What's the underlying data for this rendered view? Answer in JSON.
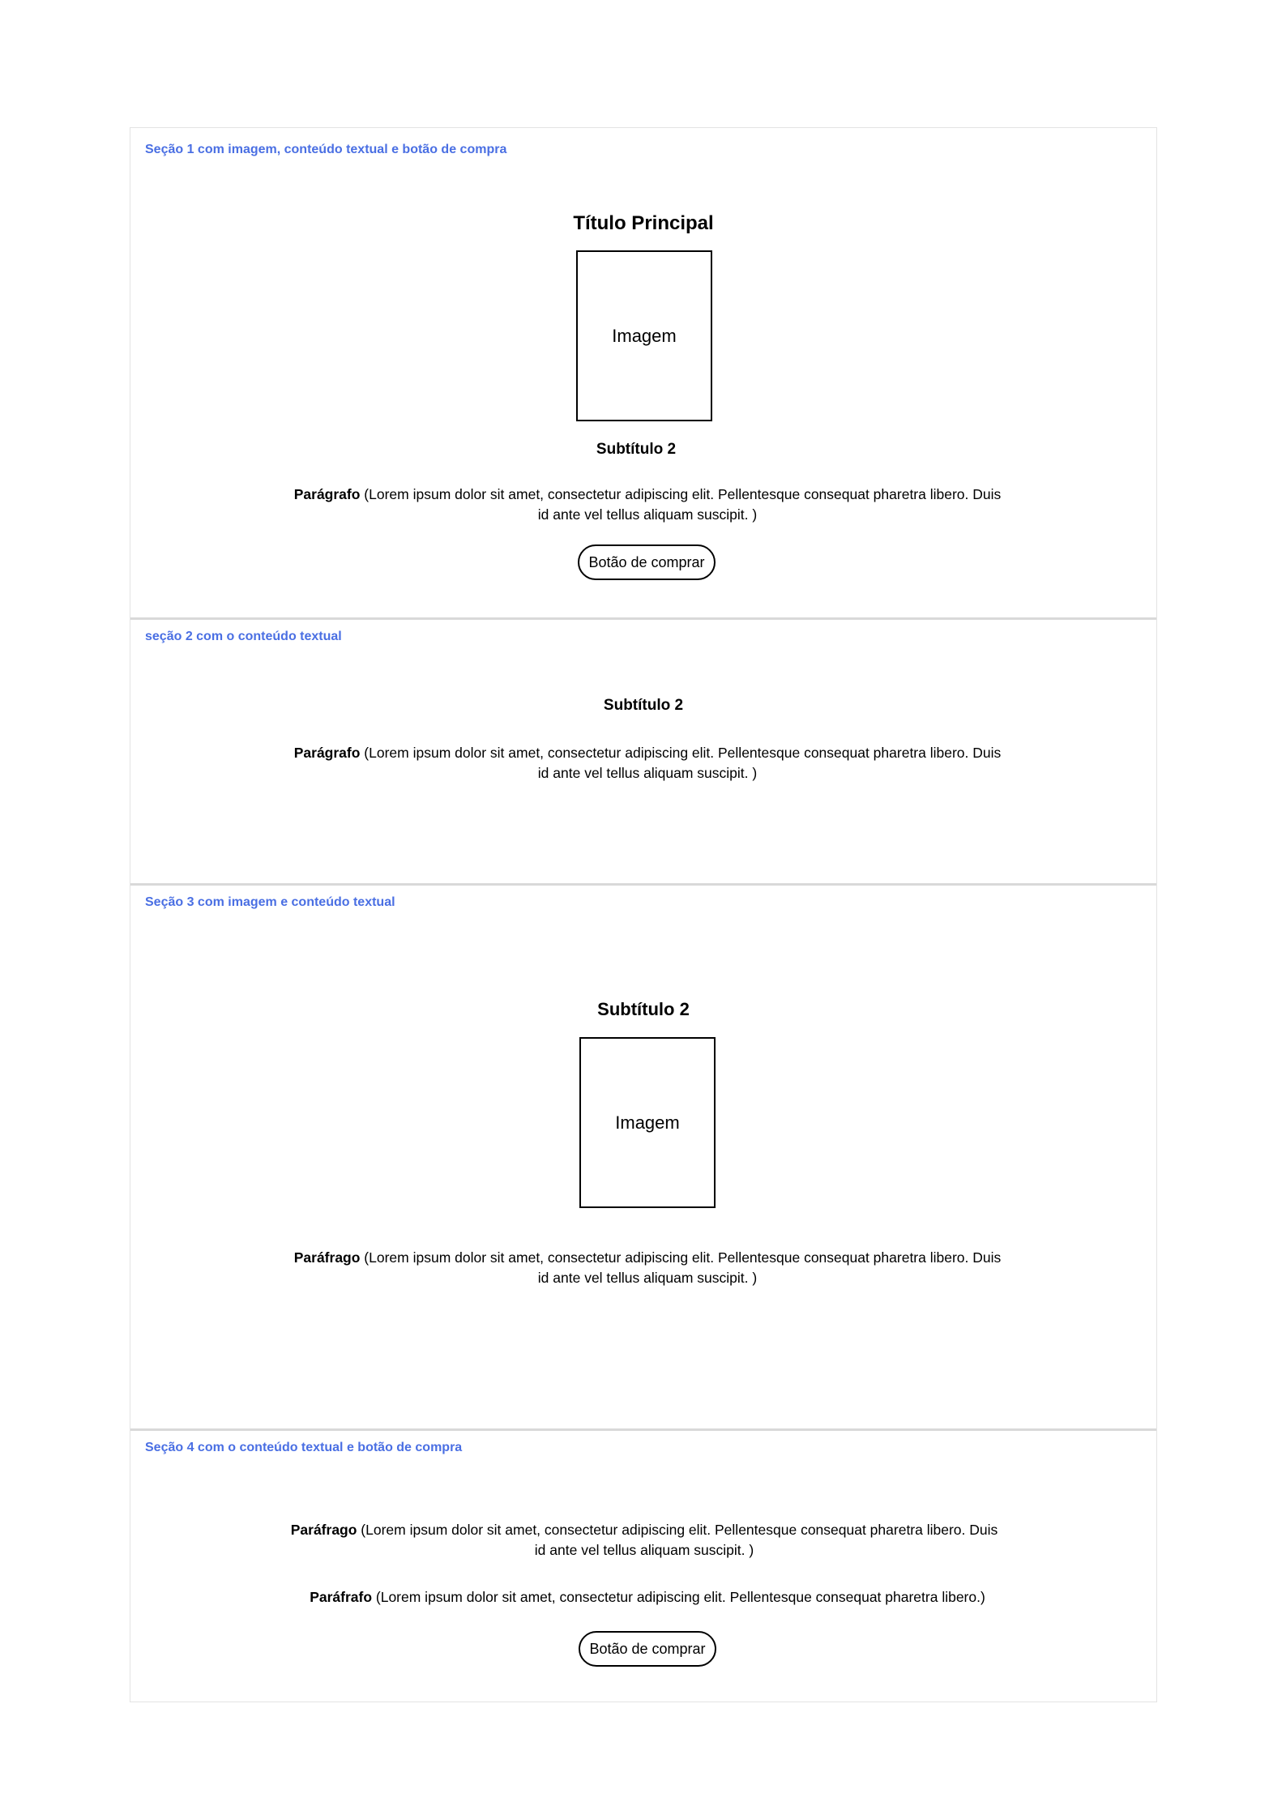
{
  "sections": [
    {
      "label": "Seção 1 com imagem, conteúdo textual e botão de compra",
      "title": "Título Principal",
      "image_label": "Imagem",
      "subtitle": "Subtítulo 2",
      "paragraph": {
        "lead": "Parágrafo",
        "text": " (Lorem ipsum dolor sit amet, consectetur adipiscing elit. Pellentesque consequat pharetra libero. Duis id ante vel tellus aliquam suscipit. )"
      },
      "buy_button": "Botão de comprar"
    },
    {
      "label": "seção 2 com o conteúdo textual",
      "subtitle": "Subtítulo 2",
      "paragraph": {
        "lead": "Parágrafo",
        "text": " (Lorem ipsum dolor sit amet, consectetur adipiscing elit. Pellentesque consequat pharetra libero. Duis id ante vel tellus aliquam suscipit. )"
      }
    },
    {
      "label": "Seção 3 com imagem e conteúdo textual",
      "subtitle": "Subtítulo 2",
      "image_label": "Imagem",
      "paragraph": {
        "lead": "Paráfrago",
        "text": " (Lorem ipsum dolor sit amet, consectetur adipiscing elit. Pellentesque consequat pharetra libero. Duis id ante vel tellus aliquam suscipit. )"
      }
    },
    {
      "label": "Seção 4 com o conteúdo textual e botão de compra",
      "paragraph_1": {
        "lead": "Paráfrago",
        "text": " (Lorem ipsum dolor sit amet, consectetur adipiscing elit. Pellentesque consequat pharetra libero. Duis id ante vel tellus aliquam suscipit. )"
      },
      "paragraph_2": {
        "lead": "Paráfrafo",
        "text": " (Lorem ipsum dolor sit amet, consectetur adipiscing elit. Pellentesque consequat pharetra libero.)"
      },
      "buy_button": "Botão de comprar"
    }
  ],
  "colors": {
    "section_label": "#4a6fe3",
    "divider": "#d9d9d9",
    "border": "#e3e3e3"
  }
}
